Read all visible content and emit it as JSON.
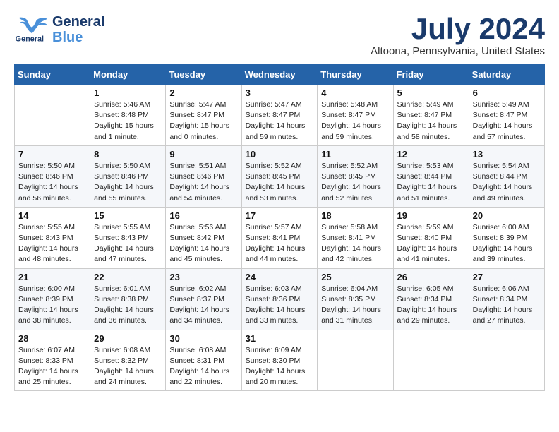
{
  "header": {
    "logo_line1": "General",
    "logo_line2": "Blue",
    "month": "July 2024",
    "location": "Altoona, Pennsylvania, United States"
  },
  "days_of_week": [
    "Sunday",
    "Monday",
    "Tuesday",
    "Wednesday",
    "Thursday",
    "Friday",
    "Saturday"
  ],
  "weeks": [
    [
      {
        "day": "",
        "info": ""
      },
      {
        "day": "1",
        "info": "Sunrise: 5:46 AM\nSunset: 8:48 PM\nDaylight: 15 hours\nand 1 minute."
      },
      {
        "day": "2",
        "info": "Sunrise: 5:47 AM\nSunset: 8:47 PM\nDaylight: 15 hours\nand 0 minutes."
      },
      {
        "day": "3",
        "info": "Sunrise: 5:47 AM\nSunset: 8:47 PM\nDaylight: 14 hours\nand 59 minutes."
      },
      {
        "day": "4",
        "info": "Sunrise: 5:48 AM\nSunset: 8:47 PM\nDaylight: 14 hours\nand 59 minutes."
      },
      {
        "day": "5",
        "info": "Sunrise: 5:49 AM\nSunset: 8:47 PM\nDaylight: 14 hours\nand 58 minutes."
      },
      {
        "day": "6",
        "info": "Sunrise: 5:49 AM\nSunset: 8:47 PM\nDaylight: 14 hours\nand 57 minutes."
      }
    ],
    [
      {
        "day": "7",
        "info": "Sunrise: 5:50 AM\nSunset: 8:46 PM\nDaylight: 14 hours\nand 56 minutes."
      },
      {
        "day": "8",
        "info": "Sunrise: 5:50 AM\nSunset: 8:46 PM\nDaylight: 14 hours\nand 55 minutes."
      },
      {
        "day": "9",
        "info": "Sunrise: 5:51 AM\nSunset: 8:46 PM\nDaylight: 14 hours\nand 54 minutes."
      },
      {
        "day": "10",
        "info": "Sunrise: 5:52 AM\nSunset: 8:45 PM\nDaylight: 14 hours\nand 53 minutes."
      },
      {
        "day": "11",
        "info": "Sunrise: 5:52 AM\nSunset: 8:45 PM\nDaylight: 14 hours\nand 52 minutes."
      },
      {
        "day": "12",
        "info": "Sunrise: 5:53 AM\nSunset: 8:44 PM\nDaylight: 14 hours\nand 51 minutes."
      },
      {
        "day": "13",
        "info": "Sunrise: 5:54 AM\nSunset: 8:44 PM\nDaylight: 14 hours\nand 49 minutes."
      }
    ],
    [
      {
        "day": "14",
        "info": "Sunrise: 5:55 AM\nSunset: 8:43 PM\nDaylight: 14 hours\nand 48 minutes."
      },
      {
        "day": "15",
        "info": "Sunrise: 5:55 AM\nSunset: 8:43 PM\nDaylight: 14 hours\nand 47 minutes."
      },
      {
        "day": "16",
        "info": "Sunrise: 5:56 AM\nSunset: 8:42 PM\nDaylight: 14 hours\nand 45 minutes."
      },
      {
        "day": "17",
        "info": "Sunrise: 5:57 AM\nSunset: 8:41 PM\nDaylight: 14 hours\nand 44 minutes."
      },
      {
        "day": "18",
        "info": "Sunrise: 5:58 AM\nSunset: 8:41 PM\nDaylight: 14 hours\nand 42 minutes."
      },
      {
        "day": "19",
        "info": "Sunrise: 5:59 AM\nSunset: 8:40 PM\nDaylight: 14 hours\nand 41 minutes."
      },
      {
        "day": "20",
        "info": "Sunrise: 6:00 AM\nSunset: 8:39 PM\nDaylight: 14 hours\nand 39 minutes."
      }
    ],
    [
      {
        "day": "21",
        "info": "Sunrise: 6:00 AM\nSunset: 8:39 PM\nDaylight: 14 hours\nand 38 minutes."
      },
      {
        "day": "22",
        "info": "Sunrise: 6:01 AM\nSunset: 8:38 PM\nDaylight: 14 hours\nand 36 minutes."
      },
      {
        "day": "23",
        "info": "Sunrise: 6:02 AM\nSunset: 8:37 PM\nDaylight: 14 hours\nand 34 minutes."
      },
      {
        "day": "24",
        "info": "Sunrise: 6:03 AM\nSunset: 8:36 PM\nDaylight: 14 hours\nand 33 minutes."
      },
      {
        "day": "25",
        "info": "Sunrise: 6:04 AM\nSunset: 8:35 PM\nDaylight: 14 hours\nand 31 minutes."
      },
      {
        "day": "26",
        "info": "Sunrise: 6:05 AM\nSunset: 8:34 PM\nDaylight: 14 hours\nand 29 minutes."
      },
      {
        "day": "27",
        "info": "Sunrise: 6:06 AM\nSunset: 8:34 PM\nDaylight: 14 hours\nand 27 minutes."
      }
    ],
    [
      {
        "day": "28",
        "info": "Sunrise: 6:07 AM\nSunset: 8:33 PM\nDaylight: 14 hours\nand 25 minutes."
      },
      {
        "day": "29",
        "info": "Sunrise: 6:08 AM\nSunset: 8:32 PM\nDaylight: 14 hours\nand 24 minutes."
      },
      {
        "day": "30",
        "info": "Sunrise: 6:08 AM\nSunset: 8:31 PM\nDaylight: 14 hours\nand 22 minutes."
      },
      {
        "day": "31",
        "info": "Sunrise: 6:09 AM\nSunset: 8:30 PM\nDaylight: 14 hours\nand 20 minutes."
      },
      {
        "day": "",
        "info": ""
      },
      {
        "day": "",
        "info": ""
      },
      {
        "day": "",
        "info": ""
      }
    ]
  ]
}
